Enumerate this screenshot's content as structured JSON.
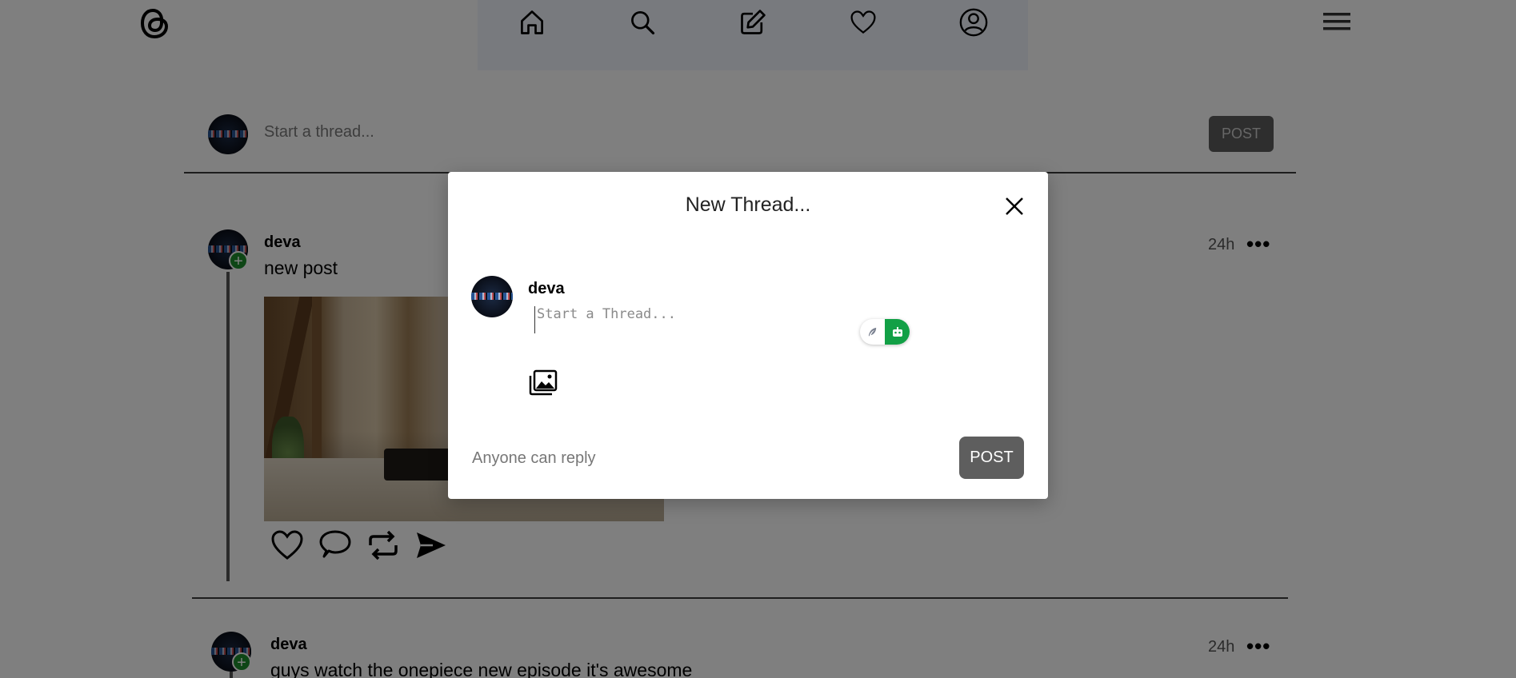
{
  "nav": {
    "items": [
      {
        "name": "home",
        "icon": "home-icon"
      },
      {
        "name": "search",
        "icon": "search-icon"
      },
      {
        "name": "create",
        "icon": "edit-icon"
      },
      {
        "name": "activity",
        "icon": "heart-icon"
      },
      {
        "name": "profile",
        "icon": "user-icon"
      }
    ],
    "menu_icon": "hamburger-menu-icon",
    "logo_icon": "threads-logo-icon"
  },
  "composer": {
    "placeholder": "Start a Thread...",
    "display_text": "Start a thread...",
    "post_label": "POST"
  },
  "posts": [
    {
      "username": "deva",
      "text": "new post",
      "time": "24h",
      "more": "•••",
      "has_image": true,
      "actions": [
        "heart-icon",
        "comment-icon",
        "repost-icon",
        "share-icon"
      ]
    },
    {
      "username": "deva",
      "text": "guys watch the onepiece new episode it's awesome",
      "time": "24h",
      "more": "•••"
    }
  ],
  "modal": {
    "title": "New Thread...",
    "username": "deva",
    "textarea_placeholder": "Start a Thread...",
    "reply_setting": "Anyone can reply",
    "post_label": "POST",
    "plus": "+"
  },
  "colors": {
    "accent_green": "#1d8c2d",
    "post_button": "#5e5e5e",
    "nav_bg": "#f0f5fc",
    "overlay": "rgba(0,0,0,0.5)"
  }
}
